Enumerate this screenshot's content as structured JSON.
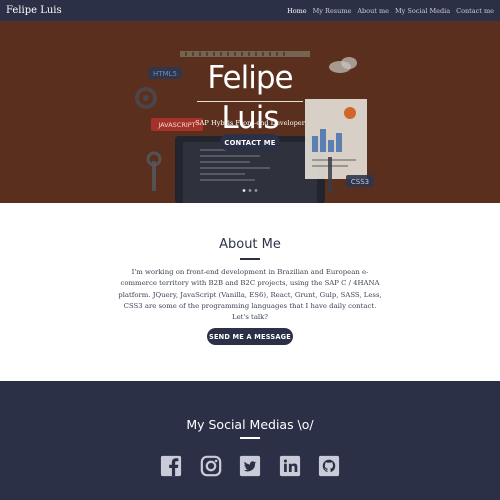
{
  "nav": {
    "brand": "Felipe Luis",
    "items": [
      {
        "label": "Home",
        "active": true
      },
      {
        "label": "My Resume",
        "active": false
      },
      {
        "label": "About me",
        "active": false
      },
      {
        "label": "My Social Media",
        "active": false
      },
      {
        "label": "Contact me",
        "active": false
      }
    ]
  },
  "hero": {
    "logo_text": "Felipe Luis",
    "subtitle": "SAP Hybris Front-end Developer",
    "contact_button": "CONTACT ME",
    "illustration_labels": {
      "html": "HTML5",
      "javascript": "JAVASCRIPT",
      "css": "CSS3"
    }
  },
  "about": {
    "title": "About Me",
    "text": "I'm working on front-end development in Brazilian and European e-commerce territory with B2B and B2C projects, using the SAP C / 4HANA platform. JQuery, JavaScript (Vanilla, ES6), React, Grunt, Gulp, SASS, Less, CSS3 are some of the programming languages that I have daily contact. Let's talk?",
    "button": "SEND ME A MESSAGE"
  },
  "social": {
    "title": "My Social Medias \\o/",
    "icons": [
      "facebook-icon",
      "instagram-icon",
      "twitter-icon",
      "linkedin-icon",
      "github-icon"
    ]
  },
  "colors": {
    "navy": "#2b3047",
    "hero_bg": "#6e3a24",
    "white": "#ffffff"
  }
}
